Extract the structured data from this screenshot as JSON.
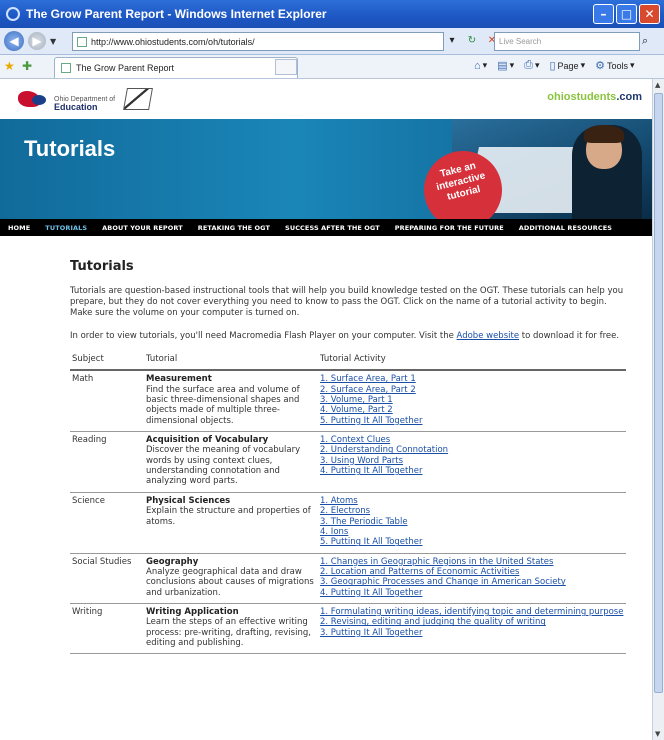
{
  "browser": {
    "title": "The Grow Parent Report - Windows Internet Explorer",
    "url": "http://www.ohiostudents.com/oh/tutorials/",
    "search_placeholder": "Live Search",
    "tab_label": "The Grow Parent Report",
    "page_menu": "Page",
    "tools_menu": "Tools"
  },
  "site": {
    "logo_small": "Ohio Department of",
    "logo_edu": "Education",
    "brand_green": "ohiostudents",
    "brand_suffix": ".com",
    "banner_title": "Tutorials",
    "promo_lines": [
      "Take an",
      "interactive",
      "tutorial"
    ]
  },
  "nav": [
    "HOME",
    "TUTORIALS",
    "ABOUT YOUR REPORT",
    "RETAKING THE OGT",
    "SUCCESS AFTER THE OGT",
    "PREPARING FOR THE FUTURE",
    "ADDITIONAL RESOURCES"
  ],
  "content": {
    "heading": "Tutorials",
    "intro": "Tutorials are question-based instructional tools that will help you build knowledge tested on the OGT. These tutorials can help you prepare, but they do not cover everything you need to know to pass the OGT. Click on the name of a tutorial activity to begin. Make sure the volume on your computer is turned on.",
    "flash_before": "In order to view tutorials, you'll need Macromedia Flash Player on your computer. Visit the ",
    "flash_link": "Adobe website",
    "flash_after": " to download it for free."
  },
  "table": {
    "headers": [
      "Subject",
      "Tutorial",
      "Tutorial Activity"
    ],
    "rows": [
      {
        "subject": "Math",
        "name": "Measurement",
        "desc": "Find the surface area and volume of basic three-dimensional shapes and objects made of multiple three-dimensional objects.",
        "activities": [
          "1. Surface Area, Part 1",
          "2. Surface Area, Part 2",
          "3. Volume, Part 1",
          "4. Volume, Part 2",
          "5. Putting It All Together"
        ]
      },
      {
        "subject": "Reading",
        "name": "Acquisition of Vocabulary",
        "desc": "Discover the meaning of vocabulary words by using context clues, understanding connotation and analyzing word parts.",
        "activities": [
          "1. Context Clues",
          "2. Understanding Connotation",
          "3. Using Word Parts",
          "4. Putting It All Together"
        ]
      },
      {
        "subject": "Science",
        "name": "Physical Sciences",
        "desc": "Explain the structure and properties of atoms.",
        "activities": [
          "1. Atoms",
          "2. Electrons",
          "3. The Periodic Table",
          "4. Ions",
          "5. Putting It All Together"
        ]
      },
      {
        "subject": "Social Studies",
        "name": "Geography",
        "desc": "Analyze geographical data and draw conclusions about causes of migrations and urbanization.",
        "activities": [
          "1. Changes in Geographic Regions in the United States",
          "2. Location and Patterns of Economic Activities",
          "3. Geographic Processes and Change in American Society",
          "4. Putting It All Together"
        ]
      },
      {
        "subject": "Writing",
        "name": "Writing Application",
        "desc": "Learn the steps of an effective writing process: pre-writing, drafting, revising, editing and publishing.",
        "activities": [
          "1. Formulating writing ideas, identifying topic and determining purpose",
          "2. Revising, editing and judging the quality of writing",
          "3. Putting It All Together"
        ]
      }
    ]
  },
  "colors": {
    "titlebar": "#1d57c4",
    "banner": "#1a86b8",
    "promo": "#d6303a",
    "nav_bg": "#000000",
    "nav_active": "#6fc0e8",
    "link": "#1a4fa8"
  }
}
